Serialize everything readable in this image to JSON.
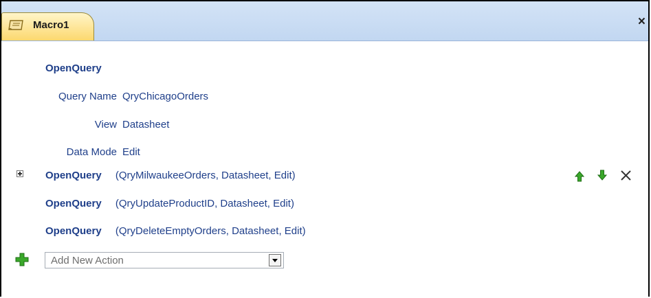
{
  "window": {
    "tab_title": "Macro1",
    "close_symbol": "×"
  },
  "actions": [
    {
      "name": "OpenQuery",
      "expanded": true,
      "arguments": [
        {
          "label": "Query Name",
          "value": "QryChicagoOrders"
        },
        {
          "label": "View",
          "value": "Datasheet"
        },
        {
          "label": "Data Mode",
          "value": "Edit"
        }
      ]
    },
    {
      "name": "OpenQuery",
      "expanded": false,
      "selected": true,
      "summary": "(QryMilwaukeeOrders, Datasheet, Edit)"
    },
    {
      "name": "OpenQuery",
      "expanded": false,
      "summary": "(QryUpdateProductID, Datasheet, Edit)"
    },
    {
      "name": "OpenQuery",
      "expanded": false,
      "summary": "(QryDeleteEmptyOrders, Datasheet, Edit)"
    }
  ],
  "add_action": {
    "placeholder": "Add New Action"
  },
  "icons": {
    "move_up": "up-arrow-icon",
    "move_down": "down-arrow-icon",
    "delete": "delete-x-icon",
    "add": "green-plus-icon",
    "expand": "expand-plus-icon",
    "macro": "macro-scroll-icon"
  },
  "colors": {
    "text_blue": "#1f3f8a",
    "tab_yellow": "#fcd86e",
    "tabstrip_blue": "#c8dbf3",
    "green_icon": "#3aa82a"
  }
}
